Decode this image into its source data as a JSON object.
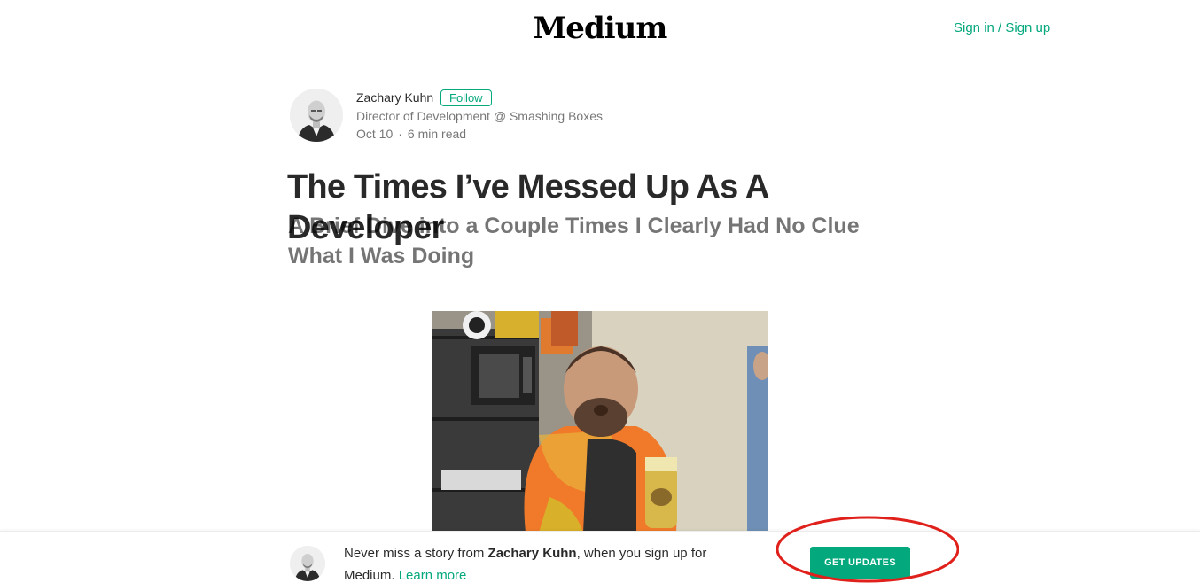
{
  "header": {
    "logo": "Medium",
    "signin_label": "Sign in / Sign up"
  },
  "author": {
    "name": "Zachary Kuhn",
    "follow_label": "Follow",
    "bio": "Director of Development @ Smashing Boxes",
    "date": "Oct 10",
    "separator": "·",
    "read_time": "6 min read"
  },
  "article": {
    "title": "The Times I’ve Messed Up As A Developer",
    "subtitle": "A Brief Dive into a Couple Times I Clearly Had No Clue What I Was Doing"
  },
  "footer": {
    "text_before": "Never miss a story from ",
    "author_name": "Zachary Kuhn",
    "text_after": ", when you sign up for Medium. ",
    "learn_more": "Learn more",
    "button_label": "GET UPDATES"
  },
  "colors": {
    "accent": "#03a87c",
    "annotation": "#e0201b"
  }
}
